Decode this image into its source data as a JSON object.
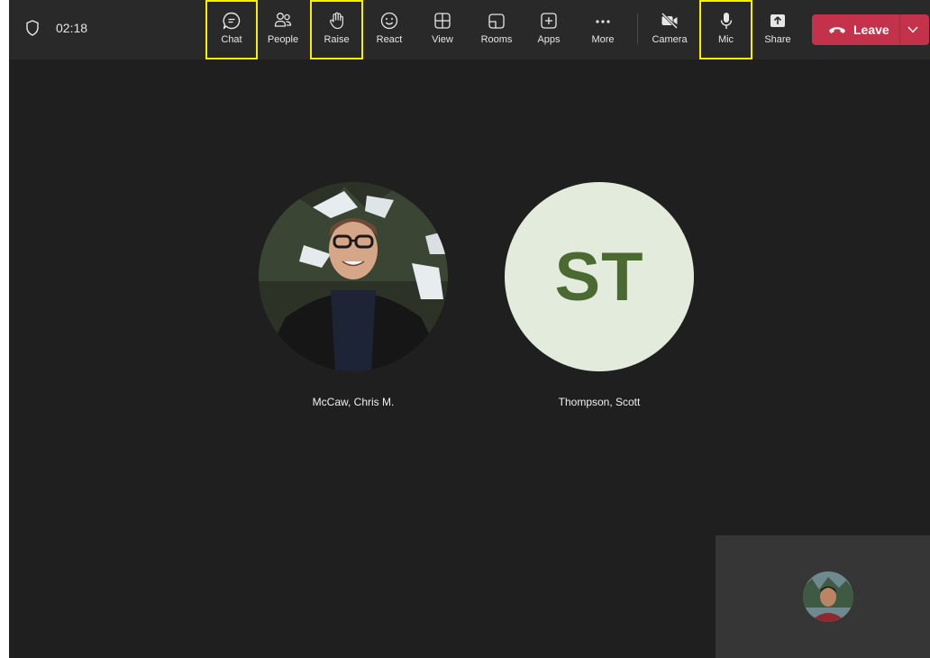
{
  "meeting": {
    "timer": "02:18"
  },
  "toolbar": {
    "buttons": [
      {
        "id": "chat",
        "label": "Chat",
        "icon": "chat-icon"
      },
      {
        "id": "people",
        "label": "People",
        "icon": "people-icon"
      },
      {
        "id": "raise",
        "label": "Raise",
        "icon": "raise-hand-icon"
      },
      {
        "id": "react",
        "label": "React",
        "icon": "smiley-icon"
      },
      {
        "id": "view",
        "label": "View",
        "icon": "grid-icon"
      },
      {
        "id": "rooms",
        "label": "Rooms",
        "icon": "rooms-icon"
      },
      {
        "id": "apps",
        "label": "Apps",
        "icon": "plus-box-icon"
      },
      {
        "id": "more",
        "label": "More",
        "icon": "ellipsis-icon"
      },
      {
        "id": "camera",
        "label": "Camera",
        "icon": "camera-off-icon"
      },
      {
        "id": "mic",
        "label": "Mic",
        "icon": "mic-icon"
      },
      {
        "id": "share",
        "label": "Share",
        "icon": "share-icon"
      }
    ],
    "leave_label": "Leave",
    "highlight_color": "#f4f000",
    "leave_color": "#c4314b"
  },
  "participants": [
    {
      "name": "McCaw, Chris M."
    },
    {
      "name": "Thompson, Scott",
      "initials": "ST",
      "avatar_bg": "#e3ebdc",
      "initials_color": "#4a6a31"
    }
  ]
}
